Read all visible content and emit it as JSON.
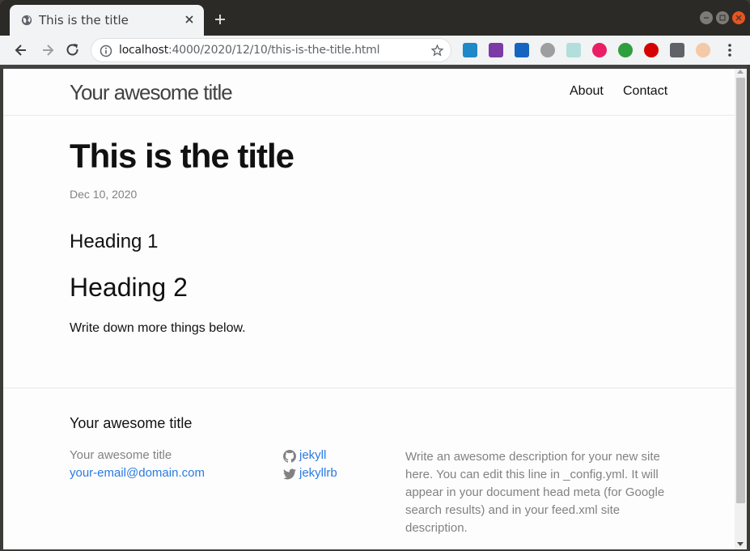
{
  "browser": {
    "tab_title": "This is the title",
    "url_host": "localhost",
    "url_path": ":4000/2020/12/10/this-is-the-title.html"
  },
  "site": {
    "title": "Your awesome title",
    "nav": {
      "about": "About",
      "contact": "Contact"
    }
  },
  "post": {
    "title": "This is the title",
    "date": "Dec 10, 2020",
    "heading1": "Heading 1",
    "heading2": "Heading 2",
    "paragraph": "Write down more things below."
  },
  "footer": {
    "heading": "Your awesome title",
    "name": "Your awesome title",
    "email": "your-email@domain.com",
    "github": "jekyll",
    "twitter": "jekyllrb",
    "description": "Write an awesome description for your new site here. You can edit this line in _config.yml. It will appear in your document head meta (for Google search results) and in your feed.xml site description."
  },
  "colors": {
    "link": "#2a7ae2",
    "muted": "#828282",
    "text": "#111111"
  },
  "icons": [
    "globe-icon",
    "close-icon",
    "plus-icon",
    "back-icon",
    "forward-icon",
    "reload-icon",
    "info-icon",
    "star-icon",
    "github-icon",
    "twitter-icon",
    "menu-icon"
  ]
}
